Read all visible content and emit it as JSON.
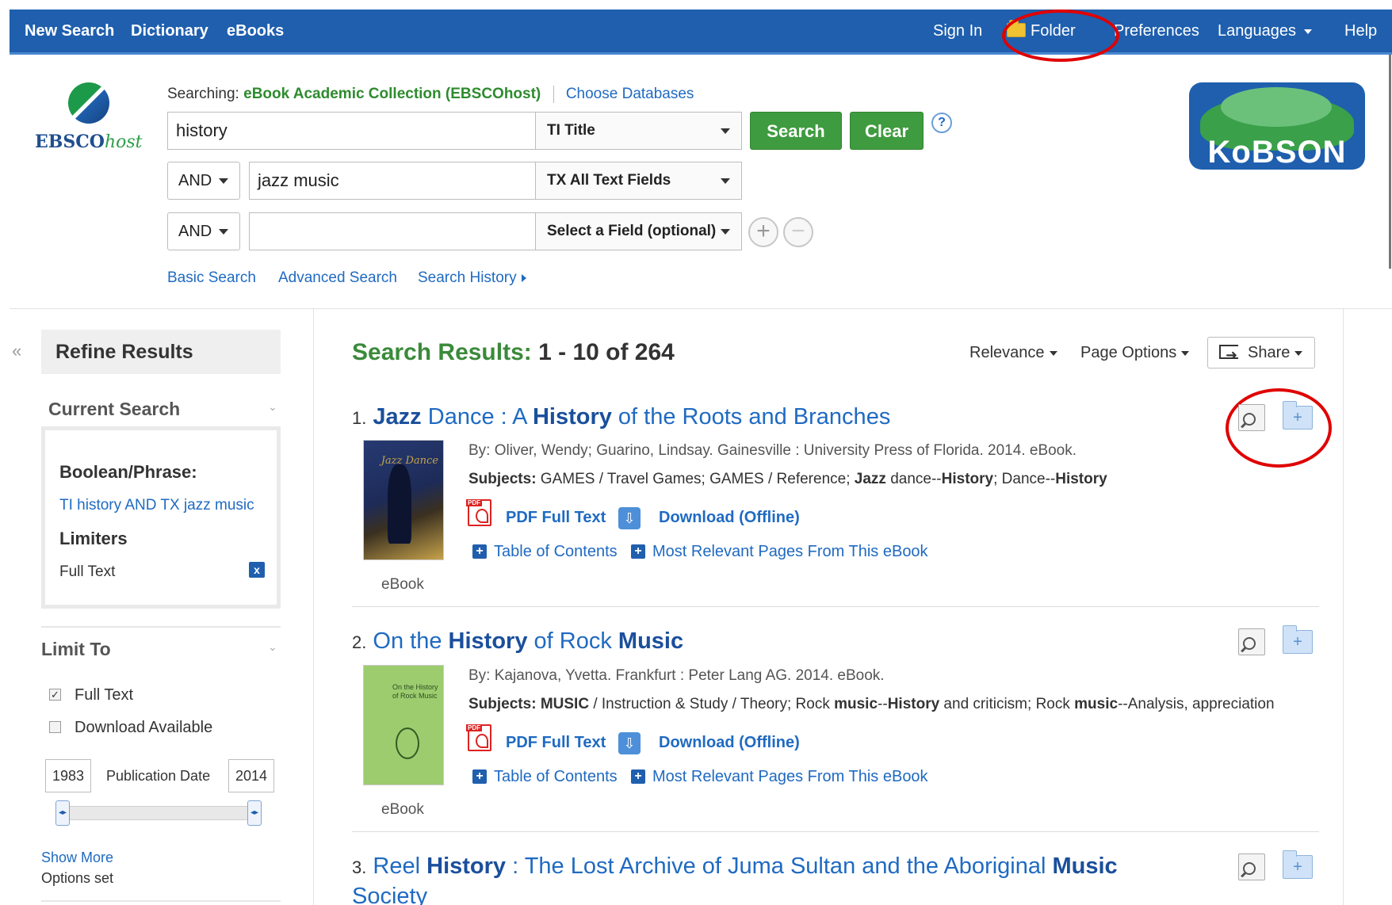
{
  "topbar": {
    "left": [
      "New Search",
      "Dictionary",
      "eBooks"
    ],
    "sign_in": "Sign In",
    "folder": "Folder",
    "preferences": "Preferences",
    "languages": "Languages",
    "help": "Help"
  },
  "header": {
    "logo_main": "EBSCO",
    "logo_sub": "host",
    "searching_label": "Searching:",
    "database": "eBook Academic Collection (EBSCOhost)",
    "choose_db": "Choose Databases",
    "kobson": "KoBSON"
  },
  "search": {
    "rows": [
      {
        "bool": "",
        "value": "history",
        "field": "TI Title"
      },
      {
        "bool": "AND",
        "value": "jazz music",
        "field": "TX All Text Fields"
      },
      {
        "bool": "AND",
        "value": "",
        "field": "Select a Field (optional)"
      }
    ],
    "search_btn": "Search",
    "clear_btn": "Clear",
    "help": "?",
    "links": {
      "basic": "Basic Search",
      "advanced": "Advanced Search",
      "history": "Search History"
    }
  },
  "sidebar": {
    "collapse": "«",
    "refine": "Refine Results",
    "current_search": "Current Search",
    "boolean_phrase": "Boolean/Phrase:",
    "query": "TI history AND TX jazz music",
    "limiters": "Limiters",
    "limiter_value": "Full Text",
    "remove": "x",
    "limit_to": "Limit To",
    "options": [
      {
        "label": "Full Text",
        "checked": true
      },
      {
        "label": "Download Available",
        "checked": false
      }
    ],
    "date_from": "1983",
    "date_label": "Publication Date",
    "date_to": "2014",
    "show_more": "Show More",
    "options_set": "Options set"
  },
  "results": {
    "label": "Search Results:",
    "range": "1 - 10 of 264",
    "relevance": "Relevance",
    "page_options": "Page Options",
    "share": "Share",
    "items": [
      {
        "num": "1.",
        "title_parts": [
          "Jazz",
          " Dance : A ",
          "History",
          " of the Roots and Branches"
        ],
        "by": "By: Oliver, Wendy; Guarino, Lindsay. Gainesville : University Press of Florida. 2014. eBook.",
        "subjects_label": "Subjects:",
        "subjects_parts": [
          " GAMES / Travel Games; GAMES / Reference; ",
          "Jazz",
          " dance--",
          "History",
          "; Dance--",
          "History"
        ],
        "pdf": "PDF Full Text",
        "download": "Download (Offline)",
        "toc": "Table of Contents",
        "relevant": "Most Relevant Pages From This eBook",
        "type": "eBook",
        "cover_text": "Jazz Dance"
      },
      {
        "num": "2.",
        "title_parts": [
          "On the ",
          "History",
          " of Rock ",
          "Music"
        ],
        "by": "By: Kajanova, Yvetta. Frankfurt : Peter Lang AG. 2014. eBook.",
        "subjects_label": "Subjects:",
        "subjects_parts": [
          " ",
          "MUSIC",
          " / Instruction & Study / Theory; Rock ",
          "music",
          "--",
          "History",
          " and criticism; Rock ",
          "music",
          "--Analysis, appreciation"
        ],
        "pdf": "PDF Full Text",
        "download": "Download (Offline)",
        "toc": "Table of Contents",
        "relevant": "Most Relevant Pages From This eBook",
        "type": "eBook",
        "cover_text": "On the History of Rock Music"
      },
      {
        "num": "3.",
        "title_parts": [
          "Reel ",
          "History",
          " : The Lost Archive of Juma Sultan and the Aboriginal ",
          "Music"
        ],
        "title_line2": "Society"
      }
    ]
  },
  "colors": {
    "topbar": "#1f5fae",
    "link": "#1f6ac2",
    "green_button": "#3f9b3f",
    "annotation": "#e00000"
  }
}
